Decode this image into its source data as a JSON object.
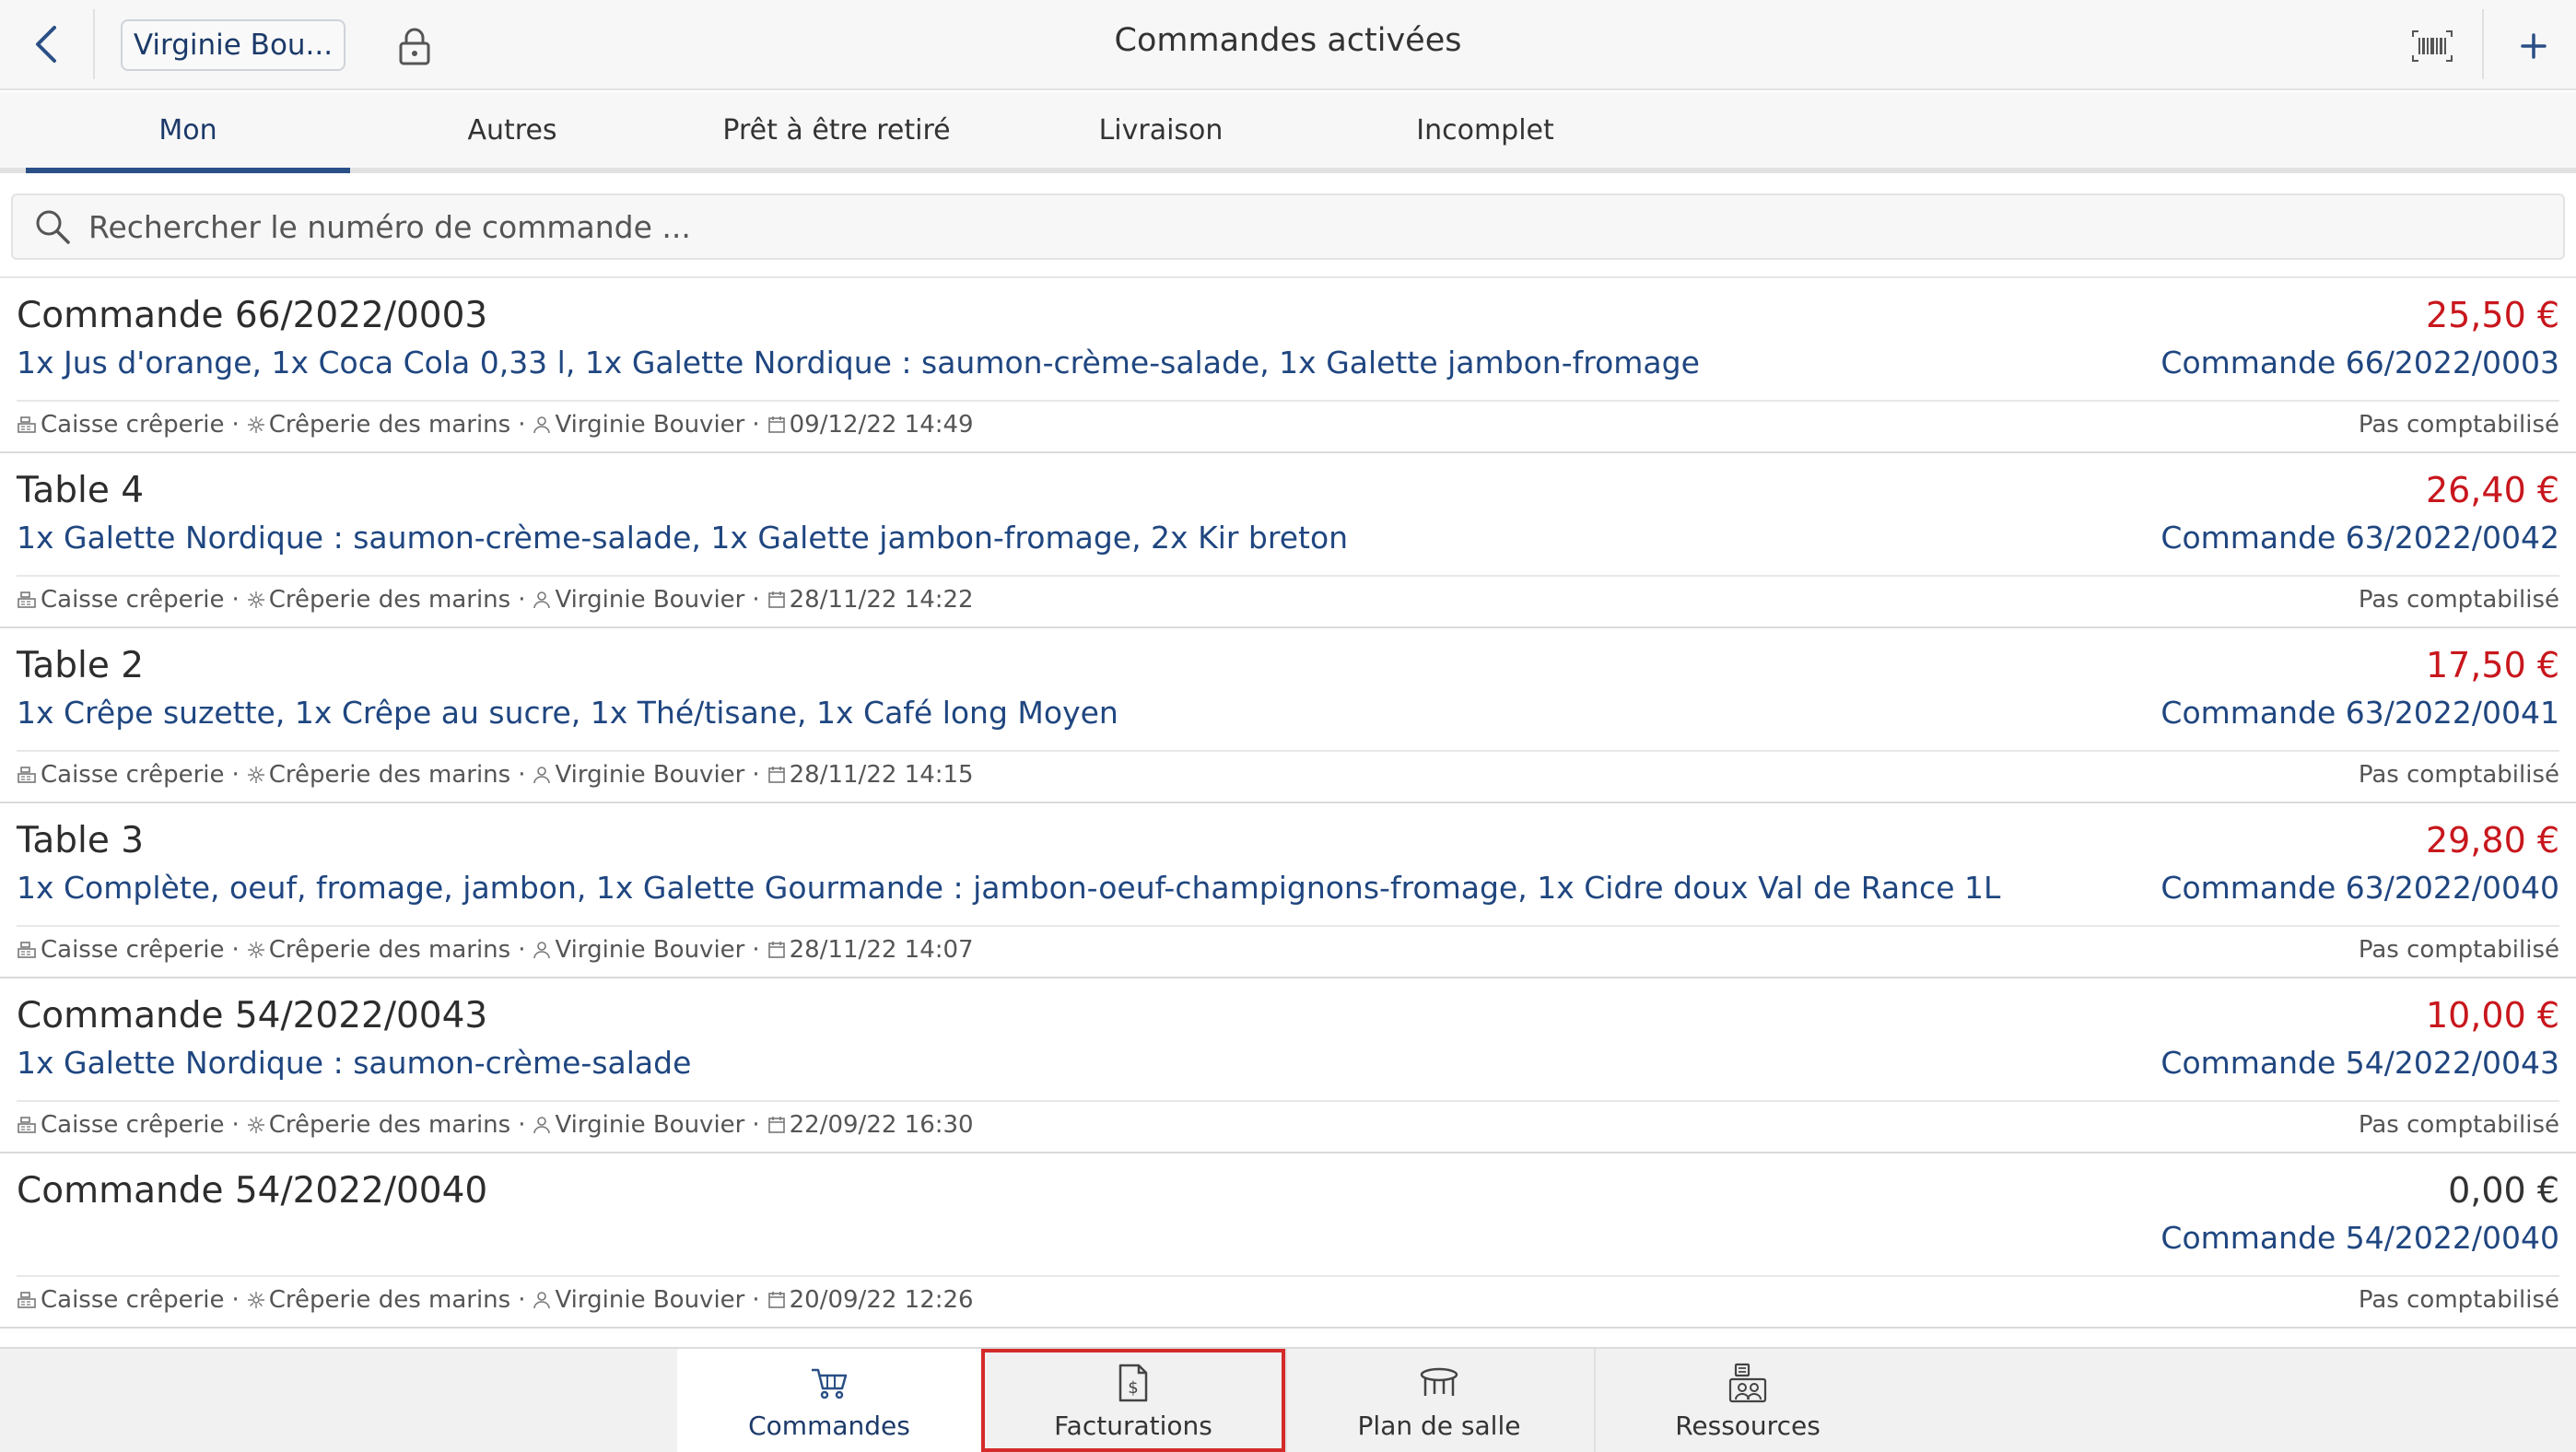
{
  "header": {
    "title": "Commandes activées",
    "user_button": "Virginie Bou..."
  },
  "tabs": [
    {
      "label": "Mon",
      "active": true
    },
    {
      "label": "Autres",
      "active": false
    },
    {
      "label": "Prêt à être retiré",
      "active": false
    },
    {
      "label": "Livraison",
      "active": false
    },
    {
      "label": "Incomplet",
      "active": false
    }
  ],
  "search": {
    "placeholder": "Rechercher le numéro de commande ..."
  },
  "orders": [
    {
      "title": "Commande 66/2022/0003",
      "amount": "25,50 €",
      "items": "1x Jus d'orange, 1x Coca Cola 0,33 l, 1x Galette Nordique : saumon-crème-salade, 1x Galette jambon-fromage",
      "ref": "Commande 66/2022/0003",
      "register": "Caisse crêperie",
      "location": "Crêperie des marins",
      "user": "Virginie Bouvier",
      "date": "09/12/22 14:49",
      "status": "Pas comptabilisé"
    },
    {
      "title": "Table 4",
      "amount": "26,40 €",
      "items": "1x Galette Nordique : saumon-crème-salade, 1x Galette jambon-fromage, 2x Kir breton",
      "ref": "Commande 63/2022/0042",
      "register": "Caisse crêperie",
      "location": "Crêperie des marins",
      "user": "Virginie Bouvier",
      "date": "28/11/22 14:22",
      "status": "Pas comptabilisé"
    },
    {
      "title": "Table 2",
      "amount": "17,50 €",
      "items": "1x Crêpe suzette, 1x Crêpe au sucre, 1x Thé/tisane, 1x Café long Moyen",
      "ref": "Commande 63/2022/0041",
      "register": "Caisse crêperie",
      "location": "Crêperie des marins",
      "user": "Virginie Bouvier",
      "date": "28/11/22 14:15",
      "status": "Pas comptabilisé"
    },
    {
      "title": "Table 3",
      "amount": "29,80 €",
      "items": "1x Complète, oeuf, fromage, jambon, 1x Galette Gourmande : jambon-oeuf-champignons-fromage, 1x Cidre doux Val de Rance 1L",
      "ref": "Commande 63/2022/0040",
      "register": "Caisse crêperie",
      "location": "Crêperie des marins",
      "user": "Virginie Bouvier",
      "date": "28/11/22 14:07",
      "status": "Pas comptabilisé"
    },
    {
      "title": "Commande 54/2022/0043",
      "amount": "10,00 €",
      "items": "1x Galette Nordique : saumon-crème-salade",
      "ref": "Commande 54/2022/0043",
      "register": "Caisse crêperie",
      "location": "Crêperie des marins",
      "user": "Virginie Bouvier",
      "date": "22/09/22 16:30",
      "status": "Pas comptabilisé"
    },
    {
      "title": "Commande 54/2022/0040",
      "amount": "0,00 €",
      "items": "",
      "ref": "Commande 54/2022/0040",
      "register": "Caisse crêperie",
      "location": "Crêperie des marins",
      "user": "Virginie Bouvier",
      "date": "20/09/22 12:26",
      "status": "Pas comptabilisé"
    }
  ],
  "bottom_nav": [
    {
      "label": "Commandes",
      "icon": "cart-icon",
      "active": true
    },
    {
      "label": "Facturations",
      "icon": "invoice-icon",
      "highlighted": true
    },
    {
      "label": "Plan de salle",
      "icon": "table-icon"
    },
    {
      "label": "Ressources",
      "icon": "resources-icon"
    }
  ],
  "colors": {
    "accent": "#1c3a69",
    "link": "#1f4680",
    "amount": "#c8171d",
    "highlight_border": "#d42a2a"
  }
}
